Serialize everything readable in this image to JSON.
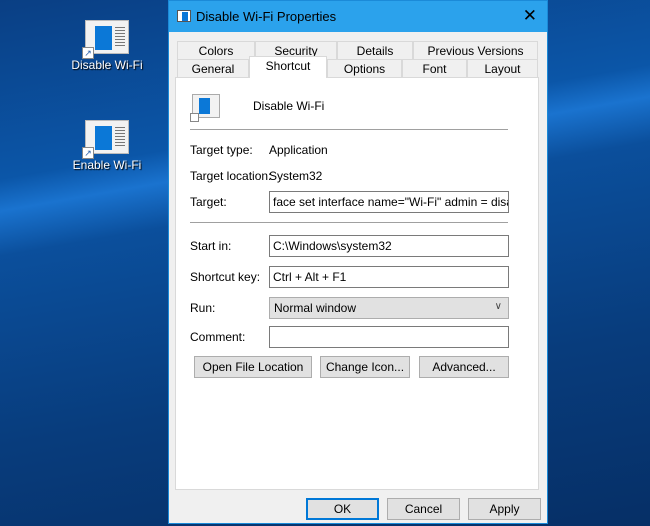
{
  "desktop": {
    "icons": [
      {
        "label": "Disable Wi-Fi"
      },
      {
        "label": "Enable Wi-Fi"
      }
    ]
  },
  "window": {
    "title": "Disable Wi-Fi Properties",
    "close": "✕"
  },
  "tabs": {
    "row1": [
      "Colors",
      "Security",
      "Details",
      "Previous Versions"
    ],
    "row2": [
      "General",
      "Shortcut",
      "Options",
      "Font",
      "Layout"
    ],
    "selected": "Shortcut"
  },
  "shortcut": {
    "name": "Disable Wi-Fi",
    "target_type_label": "Target type:",
    "target_type": "Application",
    "target_location_label": "Target location:",
    "target_location": "System32",
    "target_label": "Target:",
    "target": "face set interface name=\"Wi-Fi\" admin = disabled",
    "start_in_label": "Start in:",
    "start_in": "C:\\Windows\\system32",
    "shortcut_key_label": "Shortcut key:",
    "shortcut_key": "Ctrl + Alt + F1",
    "run_label": "Run:",
    "run": "Normal window",
    "comment_label": "Comment:",
    "comment": "",
    "buttons": {
      "open_file_location": "Open File Location",
      "change_icon": "Change Icon...",
      "advanced": "Advanced..."
    }
  },
  "footer": {
    "ok": "OK",
    "cancel": "Cancel",
    "apply": "Apply"
  }
}
